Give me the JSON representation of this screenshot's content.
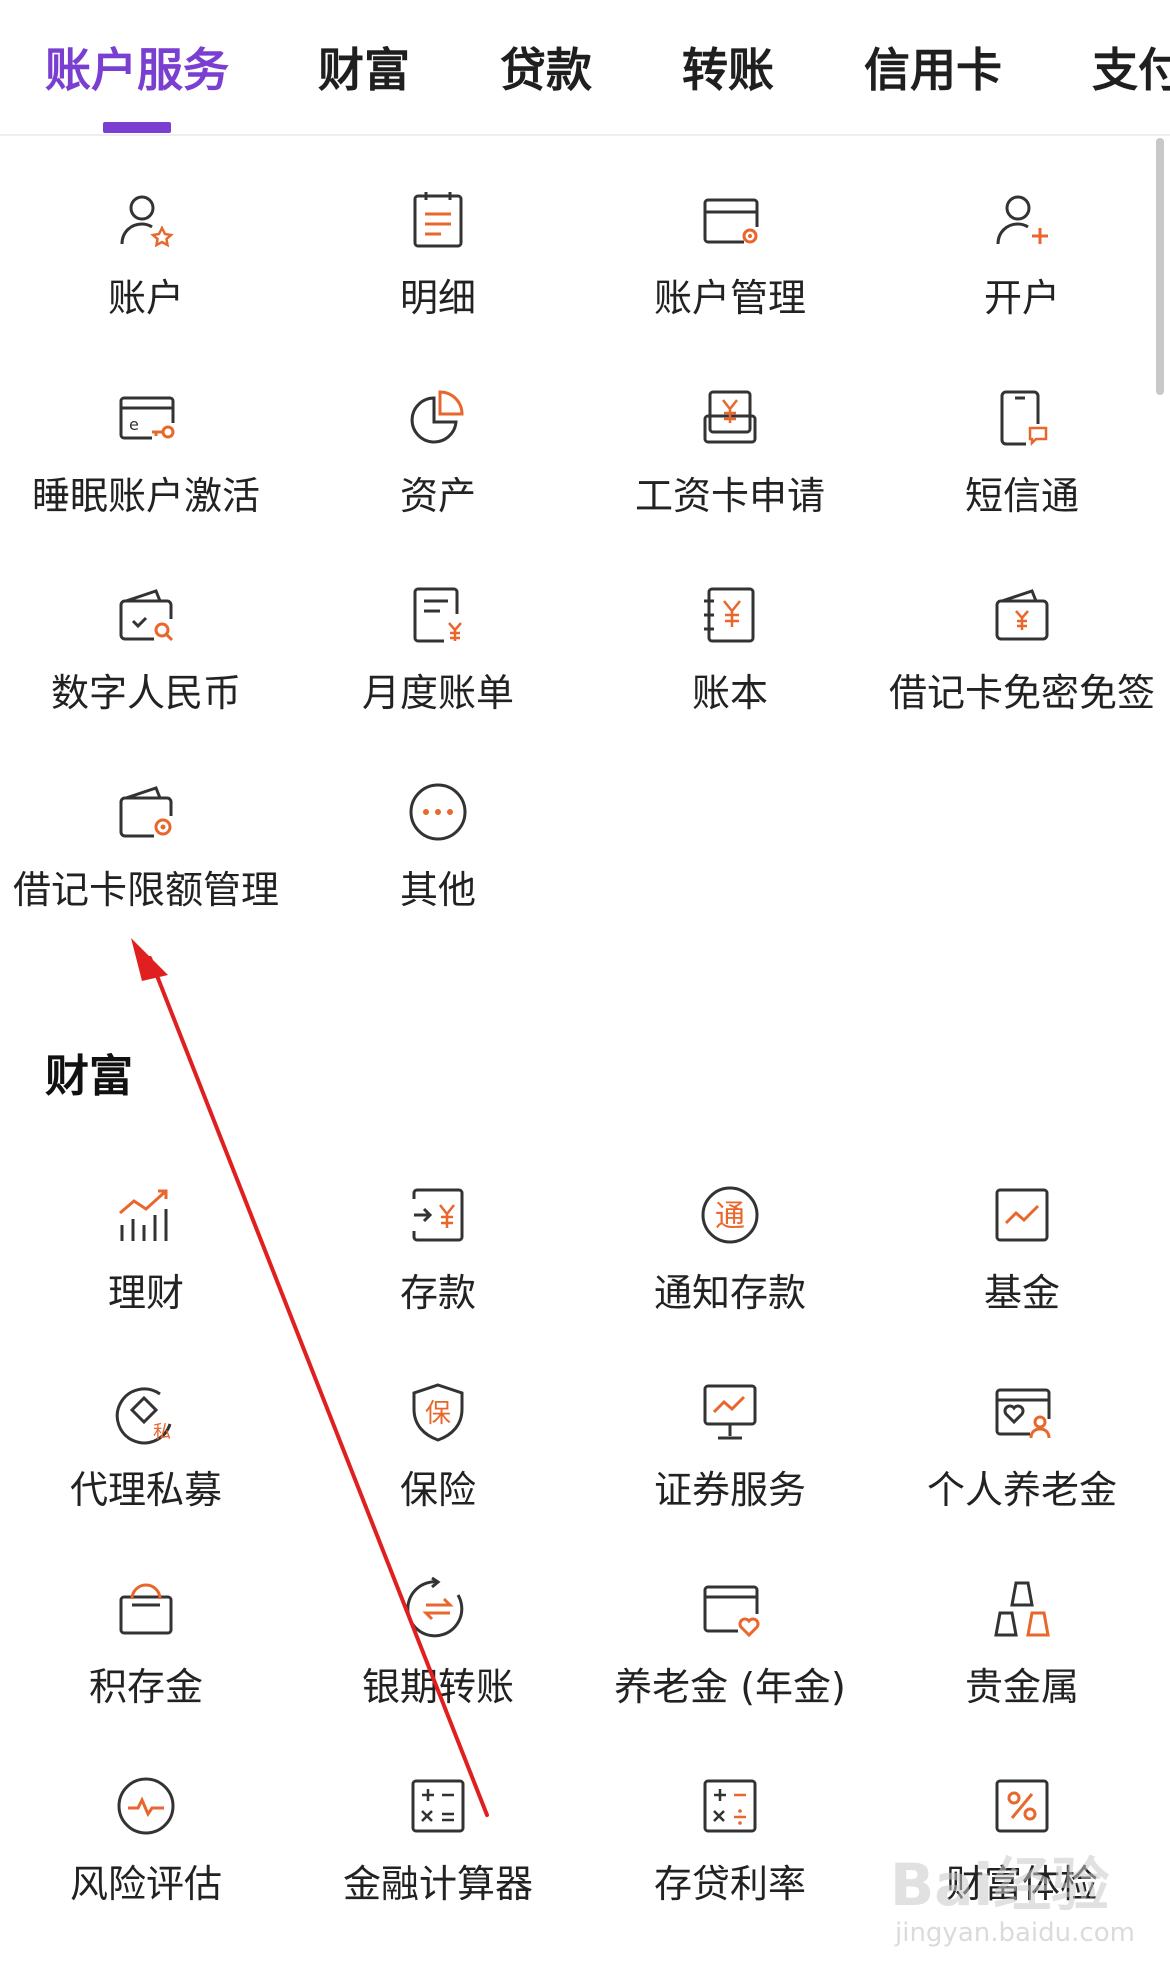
{
  "tabs": [
    {
      "label": "账户服务",
      "active": true
    },
    {
      "label": "财富",
      "active": false
    },
    {
      "label": "贷款",
      "active": false
    },
    {
      "label": "转账",
      "active": false
    },
    {
      "label": "信用卡",
      "active": false
    },
    {
      "label": "支付",
      "active": false
    }
  ],
  "account_service": {
    "items": [
      {
        "label": "账户",
        "icon": "user-star-icon"
      },
      {
        "label": "明细",
        "icon": "calendar-list-icon"
      },
      {
        "label": "账户管理",
        "icon": "card-gear-icon"
      },
      {
        "label": "开户",
        "icon": "user-plus-icon"
      },
      {
        "label": "睡眠账户激活",
        "icon": "card-key-icon"
      },
      {
        "label": "资产",
        "icon": "pie-chart-icon"
      },
      {
        "label": "工资卡申请",
        "icon": "salary-card-icon"
      },
      {
        "label": "短信通",
        "icon": "phone-message-icon"
      },
      {
        "label": "数字人民币",
        "icon": "wallet-search-icon"
      },
      {
        "label": "月度账单",
        "icon": "bill-yuan-icon"
      },
      {
        "label": "账本",
        "icon": "ledger-yuan-icon"
      },
      {
        "label": "借记卡免密免签",
        "icon": "wallet-yuan-icon"
      },
      {
        "label": "借记卡限额管理",
        "icon": "wallet-gear-icon"
      },
      {
        "label": "其他",
        "icon": "more-dots-icon"
      }
    ]
  },
  "wealth": {
    "title": "财富",
    "items": [
      {
        "label": "理财",
        "icon": "growth-chart-icon"
      },
      {
        "label": "存款",
        "icon": "deposit-icon"
      },
      {
        "label": "通知存款",
        "icon": "notice-deposit-icon"
      },
      {
        "label": "基金",
        "icon": "fund-chart-icon"
      },
      {
        "label": "代理私募",
        "icon": "private-fund-icon"
      },
      {
        "label": "保险",
        "icon": "insurance-shield-icon"
      },
      {
        "label": "证券服务",
        "icon": "monitor-chart-icon"
      },
      {
        "label": "个人养老金",
        "icon": "pension-card-icon"
      },
      {
        "label": "积存金",
        "icon": "gold-box-icon"
      },
      {
        "label": "银期转账",
        "icon": "exchange-icon"
      },
      {
        "label": "养老金 (年金)",
        "icon": "card-heart-icon"
      },
      {
        "label": "贵金属",
        "icon": "gold-bars-icon"
      },
      {
        "label": "风险评估",
        "icon": "pulse-icon"
      },
      {
        "label": "金融计算器",
        "icon": "calculator-icon"
      },
      {
        "label": "存贷利率",
        "icon": "rate-calculator-icon"
      },
      {
        "label": "财富体检",
        "icon": "percent-icon"
      }
    ]
  },
  "colors": {
    "accent": "#7a3fd1",
    "icon_stroke": "#333333",
    "icon_accent": "#e8672d",
    "arrow": "#e02020"
  },
  "watermark": {
    "main": "Bai经验",
    "sub": "jingyan.baidu.com"
  }
}
